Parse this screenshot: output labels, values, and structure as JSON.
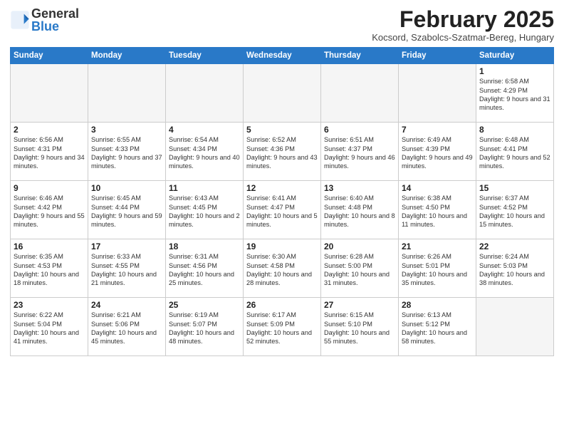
{
  "header": {
    "logo_general": "General",
    "logo_blue": "Blue",
    "title": "February 2025",
    "subtitle": "Kocsord, Szabolcs-Szatmar-Bereg, Hungary"
  },
  "days_of_week": [
    "Sunday",
    "Monday",
    "Tuesday",
    "Wednesday",
    "Thursday",
    "Friday",
    "Saturday"
  ],
  "weeks": [
    [
      {
        "day": "",
        "info": ""
      },
      {
        "day": "",
        "info": ""
      },
      {
        "day": "",
        "info": ""
      },
      {
        "day": "",
        "info": ""
      },
      {
        "day": "",
        "info": ""
      },
      {
        "day": "",
        "info": ""
      },
      {
        "day": "1",
        "info": "Sunrise: 6:58 AM\nSunset: 4:29 PM\nDaylight: 9 hours and 31 minutes."
      }
    ],
    [
      {
        "day": "2",
        "info": "Sunrise: 6:56 AM\nSunset: 4:31 PM\nDaylight: 9 hours and 34 minutes."
      },
      {
        "day": "3",
        "info": "Sunrise: 6:55 AM\nSunset: 4:33 PM\nDaylight: 9 hours and 37 minutes."
      },
      {
        "day": "4",
        "info": "Sunrise: 6:54 AM\nSunset: 4:34 PM\nDaylight: 9 hours and 40 minutes."
      },
      {
        "day": "5",
        "info": "Sunrise: 6:52 AM\nSunset: 4:36 PM\nDaylight: 9 hours and 43 minutes."
      },
      {
        "day": "6",
        "info": "Sunrise: 6:51 AM\nSunset: 4:37 PM\nDaylight: 9 hours and 46 minutes."
      },
      {
        "day": "7",
        "info": "Sunrise: 6:49 AM\nSunset: 4:39 PM\nDaylight: 9 hours and 49 minutes."
      },
      {
        "day": "8",
        "info": "Sunrise: 6:48 AM\nSunset: 4:41 PM\nDaylight: 9 hours and 52 minutes."
      }
    ],
    [
      {
        "day": "9",
        "info": "Sunrise: 6:46 AM\nSunset: 4:42 PM\nDaylight: 9 hours and 55 minutes."
      },
      {
        "day": "10",
        "info": "Sunrise: 6:45 AM\nSunset: 4:44 PM\nDaylight: 9 hours and 59 minutes."
      },
      {
        "day": "11",
        "info": "Sunrise: 6:43 AM\nSunset: 4:45 PM\nDaylight: 10 hours and 2 minutes."
      },
      {
        "day": "12",
        "info": "Sunrise: 6:41 AM\nSunset: 4:47 PM\nDaylight: 10 hours and 5 minutes."
      },
      {
        "day": "13",
        "info": "Sunrise: 6:40 AM\nSunset: 4:48 PM\nDaylight: 10 hours and 8 minutes."
      },
      {
        "day": "14",
        "info": "Sunrise: 6:38 AM\nSunset: 4:50 PM\nDaylight: 10 hours and 11 minutes."
      },
      {
        "day": "15",
        "info": "Sunrise: 6:37 AM\nSunset: 4:52 PM\nDaylight: 10 hours and 15 minutes."
      }
    ],
    [
      {
        "day": "16",
        "info": "Sunrise: 6:35 AM\nSunset: 4:53 PM\nDaylight: 10 hours and 18 minutes."
      },
      {
        "day": "17",
        "info": "Sunrise: 6:33 AM\nSunset: 4:55 PM\nDaylight: 10 hours and 21 minutes."
      },
      {
        "day": "18",
        "info": "Sunrise: 6:31 AM\nSunset: 4:56 PM\nDaylight: 10 hours and 25 minutes."
      },
      {
        "day": "19",
        "info": "Sunrise: 6:30 AM\nSunset: 4:58 PM\nDaylight: 10 hours and 28 minutes."
      },
      {
        "day": "20",
        "info": "Sunrise: 6:28 AM\nSunset: 5:00 PM\nDaylight: 10 hours and 31 minutes."
      },
      {
        "day": "21",
        "info": "Sunrise: 6:26 AM\nSunset: 5:01 PM\nDaylight: 10 hours and 35 minutes."
      },
      {
        "day": "22",
        "info": "Sunrise: 6:24 AM\nSunset: 5:03 PM\nDaylight: 10 hours and 38 minutes."
      }
    ],
    [
      {
        "day": "23",
        "info": "Sunrise: 6:22 AM\nSunset: 5:04 PM\nDaylight: 10 hours and 41 minutes."
      },
      {
        "day": "24",
        "info": "Sunrise: 6:21 AM\nSunset: 5:06 PM\nDaylight: 10 hours and 45 minutes."
      },
      {
        "day": "25",
        "info": "Sunrise: 6:19 AM\nSunset: 5:07 PM\nDaylight: 10 hours and 48 minutes."
      },
      {
        "day": "26",
        "info": "Sunrise: 6:17 AM\nSunset: 5:09 PM\nDaylight: 10 hours and 52 minutes."
      },
      {
        "day": "27",
        "info": "Sunrise: 6:15 AM\nSunset: 5:10 PM\nDaylight: 10 hours and 55 minutes."
      },
      {
        "day": "28",
        "info": "Sunrise: 6:13 AM\nSunset: 5:12 PM\nDaylight: 10 hours and 58 minutes."
      },
      {
        "day": "",
        "info": ""
      }
    ]
  ]
}
